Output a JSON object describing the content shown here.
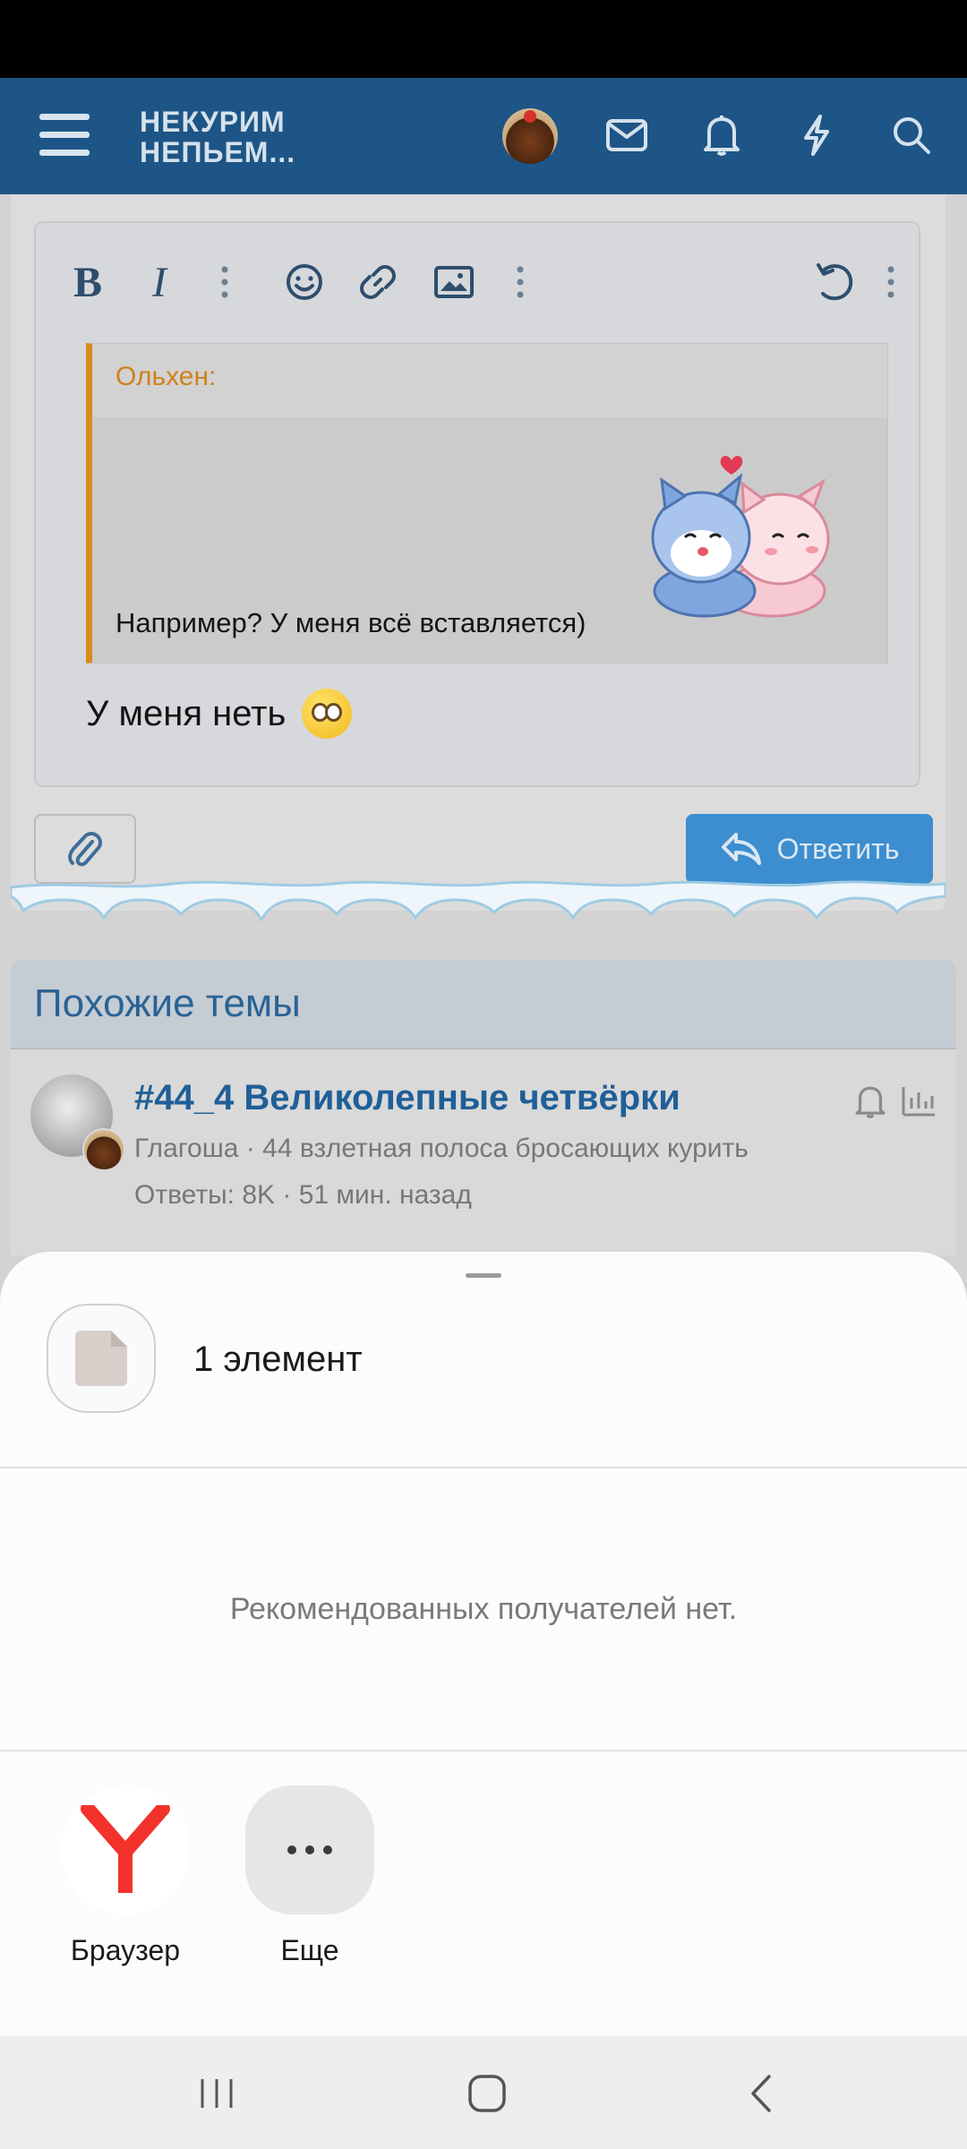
{
  "header": {
    "logo_line1": "НЕКУРИМ",
    "logo_line2": "НЕПЬЕМ..."
  },
  "editor": {
    "quote_author": "Ольхен:",
    "quote_text": "Например? У меня всё вставляется)",
    "reply_text": "У меня неть",
    "reply_button_label": "Ответить"
  },
  "similar": {
    "heading": "Похожие темы",
    "threads": [
      {
        "title": "#44_4 Великолепные четвёрки",
        "meta": "Глагоша · 44 взлетная полоса бросающих курить",
        "stats": "Ответы: 8K · 51 мин. назад"
      }
    ]
  },
  "share_sheet": {
    "item_count_label": "1 элемент",
    "no_recommendations": "Рекомендованных получателей нет.",
    "apps": [
      {
        "label": "Браузер",
        "icon": "yandex-browser-icon"
      },
      {
        "label": "Еще",
        "icon": "more-icon"
      }
    ]
  },
  "colors": {
    "header_bg": "#1d5586",
    "accent_blue": "#3c8ed0",
    "quote_border": "#d98b1f",
    "yandex_red": "#f3322c"
  }
}
